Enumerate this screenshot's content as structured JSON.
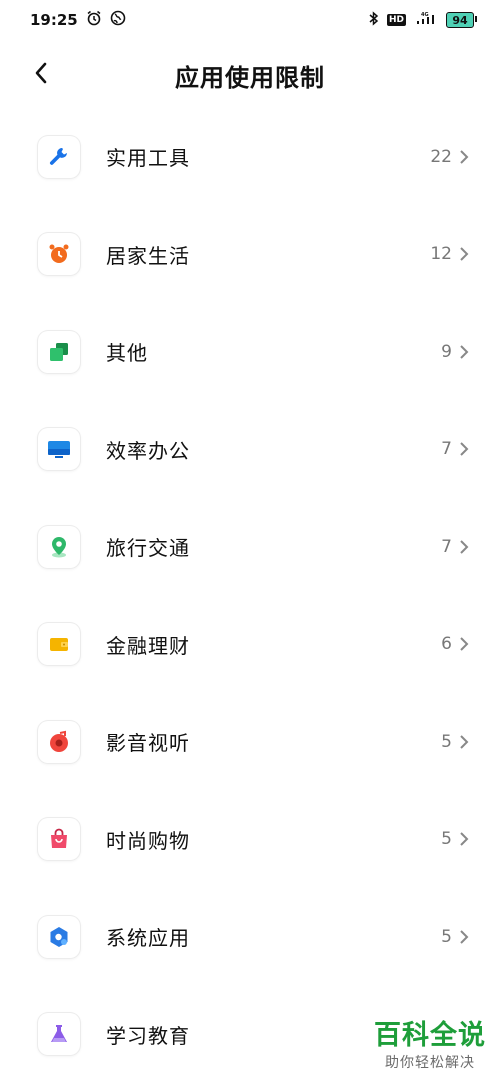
{
  "status_bar": {
    "time": "19:25",
    "hd": "HD",
    "network": "4G",
    "battery": "94"
  },
  "header": {
    "title": "应用使用限制"
  },
  "items": [
    {
      "label": "实用工具",
      "count": "22",
      "icon": "wrench-icon",
      "color": "#1a73e8"
    },
    {
      "label": "居家生活",
      "count": "12",
      "icon": "alarm-clock-icon",
      "color": "#f26b1d"
    },
    {
      "label": "其他",
      "count": "9",
      "icon": "squares-icon",
      "color": "#22b35e"
    },
    {
      "label": "效率办公",
      "count": "7",
      "icon": "monitor-icon",
      "color": "#1e88e5"
    },
    {
      "label": "旅行交通",
      "count": "7",
      "icon": "location-pin-icon",
      "color": "#2eb86a"
    },
    {
      "label": "金融理财",
      "count": "6",
      "icon": "wallet-icon",
      "color": "#f5b400"
    },
    {
      "label": "影音视听",
      "count": "5",
      "icon": "music-disc-icon",
      "color": "#f0453c"
    },
    {
      "label": "时尚购物",
      "count": "5",
      "icon": "shopping-bag-icon",
      "color": "#f04a6a"
    },
    {
      "label": "系统应用",
      "count": "5",
      "icon": "system-gear-icon",
      "color": "#2a7be4"
    },
    {
      "label": "学习教育",
      "count": "",
      "icon": "flask-icon",
      "color": "#8c5ce8"
    }
  ],
  "watermark": {
    "title": "百科全说",
    "subtitle": "助你轻松解决"
  }
}
